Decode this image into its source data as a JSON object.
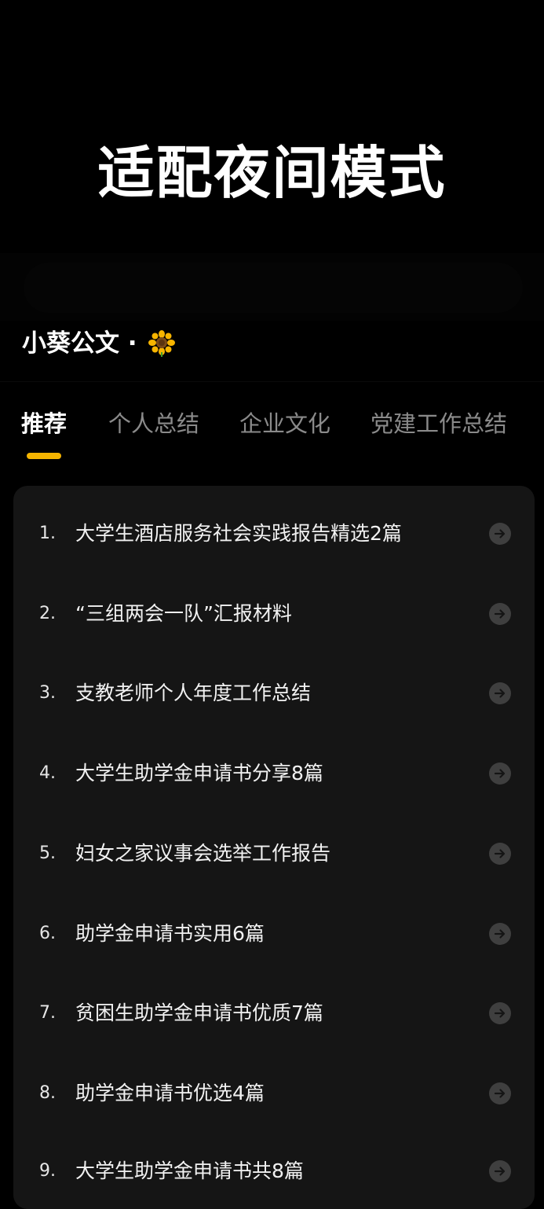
{
  "hero": {
    "title": "适配夜间模式"
  },
  "header": {
    "app_name": "小葵公文 ·",
    "emoji_icon": "sunflower-icon"
  },
  "tabs": [
    {
      "label": "推荐",
      "active": true
    },
    {
      "label": "个人总结",
      "active": false
    },
    {
      "label": "企业文化",
      "active": false
    },
    {
      "label": "党建工作总结",
      "active": false
    }
  ],
  "colors": {
    "background": "#000000",
    "card": "#151515",
    "accent": "#f5b400",
    "tab_inactive": "#8a8a8a",
    "arrow_badge": "#3f3f3f"
  },
  "list": {
    "arrow_icon": "arrow-right-circle-icon",
    "items": [
      {
        "num": "1.",
        "title": "大学生酒店服务社会实践报告精选2篇"
      },
      {
        "num": "2.",
        "title": "“三组两会一队”汇报材料"
      },
      {
        "num": "3.",
        "title": "支教老师个人年度工作总结"
      },
      {
        "num": "4.",
        "title": "大学生助学金申请书分享8篇"
      },
      {
        "num": "5.",
        "title": "妇女之家议事会选举工作报告"
      },
      {
        "num": "6.",
        "title": "助学金申请书实用6篇"
      },
      {
        "num": "7.",
        "title": "贫困生助学金申请书优质7篇"
      },
      {
        "num": "8.",
        "title": "助学金申请书优选4篇"
      },
      {
        "num": "9.",
        "title": "大学生助学金申请书共8篇"
      }
    ]
  }
}
